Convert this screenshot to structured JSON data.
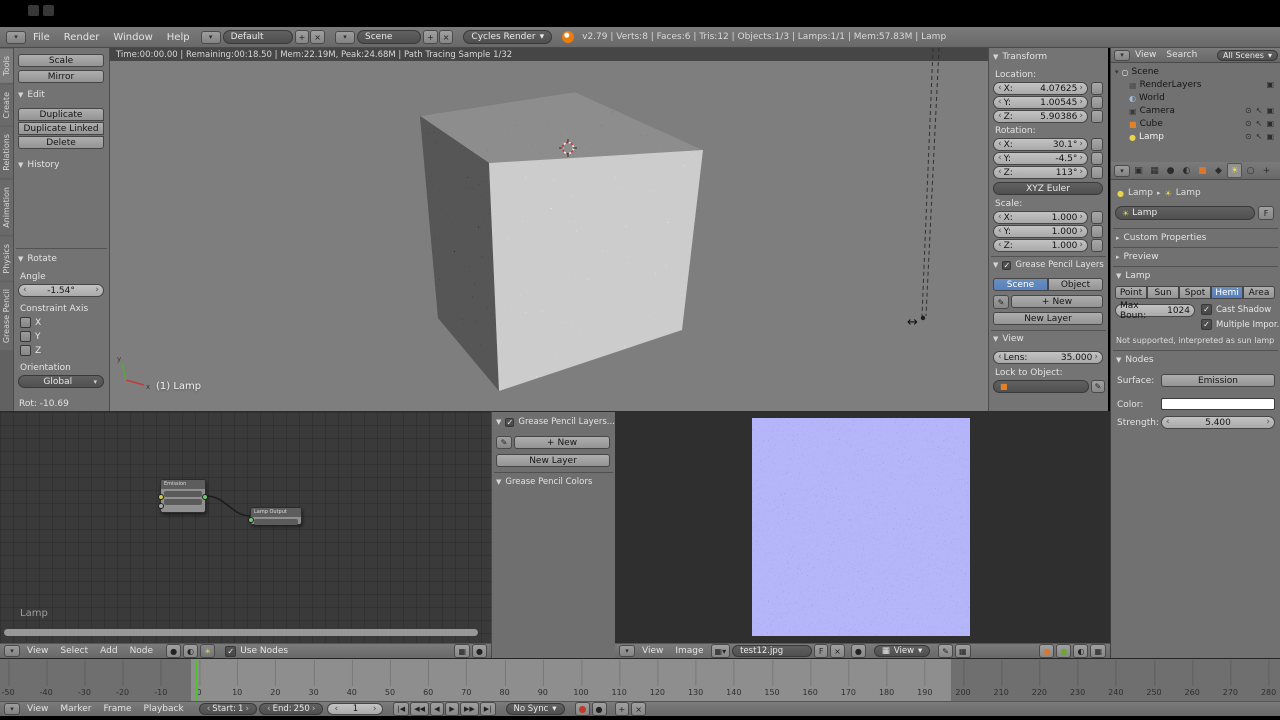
{
  "icons": {
    "dropdown": "▾",
    "collapse": "▼",
    "expand": "▸",
    "close": "×",
    "plus": "+",
    "check": "✓",
    "eye": "⊙",
    "select_arrow": "↖",
    "render_cam": "▣",
    "world_sphere": "◐",
    "image_layers": "▦",
    "lamp_sun": "☀",
    "dot": "●",
    "cube": "■",
    "pencil": "✎",
    "resize_cursor": "↔",
    "arrow_left": "‹",
    "arrow_right": "›"
  },
  "topbar": {
    "menus": [
      "File",
      "Render",
      "Window",
      "Help"
    ],
    "screen_layout": "Default",
    "scene_name": "Scene",
    "engine": "Cycles Render",
    "stats": "v2.79 | Verts:8 | Faces:6 | Tris:12 | Objects:1/3 | Lamps:1/1 | Mem:57.83M | Lamp"
  },
  "tool_shelf": {
    "tabs": [
      "Tools",
      "Create",
      "Relations",
      "Animation",
      "Physics",
      "Grease Pencil"
    ],
    "buttons": [
      "Scale",
      "Mirror"
    ],
    "edit_label": "Edit",
    "edit_buttons": [
      "Duplicate",
      "Duplicate Linked",
      "Delete"
    ],
    "history_label": "History",
    "rotate": {
      "title": "Rotate",
      "angle_label": "Angle",
      "angle_value": "-1.54°",
      "constraint_label": "Constraint Axis",
      "axes": [
        "X",
        "Y",
        "Z"
      ],
      "orientation_label": "Orientation",
      "orientation_value": "Global"
    },
    "status": "Rot: -10.69"
  },
  "viewport": {
    "render_status": "Time:00:00.00 | Remaining:00:18.50 | Mem:22.19M, Peak:24.68M | Path Tracing Sample 1/32",
    "object_info": "(1) Lamp",
    "gizmo_x": "x",
    "gizmo_y": "y"
  },
  "n_panel": {
    "transform_title": "Transform",
    "location_label": "Location:",
    "loc": [
      {
        "axis": "X:",
        "value": "4.07625"
      },
      {
        "axis": "Y:",
        "value": "1.00545"
      },
      {
        "axis": "Z:",
        "value": "5.90386"
      }
    ],
    "rotation_label": "Rotation:",
    "rot": [
      {
        "axis": "X:",
        "value": "30.1°"
      },
      {
        "axis": "Y:",
        "value": "-4.5°"
      },
      {
        "axis": "Z:",
        "value": "113°"
      }
    ],
    "rotation_mode": "XYZ Euler",
    "scale_label": "Scale:",
    "scl": [
      {
        "axis": "X:",
        "value": "1.000"
      },
      {
        "axis": "Y:",
        "value": "1.000"
      },
      {
        "axis": "Z:",
        "value": "1.000"
      }
    ],
    "gp_title": "Grease Pencil Layers",
    "gp_scene": "Scene",
    "gp_object": "Object",
    "gp_new": "New",
    "gp_new_layer": "New Layer",
    "view_title": "View",
    "lens_label": "Lens:",
    "lens_value": "35.000",
    "lock_label": "Lock to Object:"
  },
  "outliner": {
    "menu_view": "View",
    "menu_search": "Search",
    "display_mode": "All Scenes",
    "items": [
      {
        "label": "Scene",
        "icon": "○"
      },
      {
        "label": "RenderLayers",
        "icon": "▦"
      },
      {
        "label": "World",
        "icon": "◐"
      },
      {
        "label": "Camera",
        "icon": "▣"
      },
      {
        "label": "Cube",
        "icon": "■"
      },
      {
        "label": "Lamp",
        "icon": "●"
      }
    ]
  },
  "properties": {
    "tab_icons": [
      "▣",
      "▦",
      "●",
      "◐",
      "■",
      "◆",
      "☀",
      "○",
      "+"
    ],
    "breadcrumb_object": "Lamp",
    "breadcrumb_data": "Lamp",
    "name_value": "Lamp",
    "fake_user": "F",
    "custom_properties_title": "Custom Properties",
    "preview_title": "Preview",
    "lamp_title": "Lamp",
    "lamp_types": [
      "Point",
      "Sun",
      "Spot",
      "Hemi",
      "Area"
    ],
    "max_bounces_label": "Max Boun:",
    "max_bounces_value": "1024",
    "cast_shadow_label": "Cast Shadow",
    "multiple_importance_label": "Multiple Impor...",
    "note": "Not supported, interpreted as sun lamp",
    "nodes_title": "Nodes",
    "surface_label": "Surface:",
    "surface_value": "Emission",
    "color_label": "Color:",
    "strength_label": "Strength:",
    "strength_value": "5.400"
  },
  "node_editor": {
    "menus": [
      "View",
      "Select",
      "Add",
      "Node"
    ],
    "use_nodes_label": "Use Nodes",
    "id_name": "Lamp",
    "nodes": [
      {
        "title": "Emission"
      },
      {
        "title": "Lamp Output"
      }
    ]
  },
  "image_toolshelf": {
    "gp_layers_title": "Grease Pencil Layers...",
    "new_label": "New",
    "new_layer_label": "New Layer",
    "gp_colors_title": "Grease Pencil Colors"
  },
  "image_editor": {
    "menu_view": "View",
    "menu_image": "Image",
    "image_name": "test12.jpg",
    "fake_user": "F",
    "view_mode": "View"
  },
  "timeline": {
    "menus": [
      "View",
      "Marker",
      "Frame",
      "Playback"
    ],
    "start_label": "Start:",
    "start_value": "1",
    "end_label": "End:",
    "end_value": "250",
    "current_frame": "1",
    "sync_mode": "No Sync",
    "playback": [
      {
        "name": "jump-to-start",
        "glyph": "|◀"
      },
      {
        "name": "prev-keyframe",
        "glyph": "◀◀"
      },
      {
        "name": "play-reverse",
        "glyph": "◀"
      },
      {
        "name": "play",
        "glyph": "▶"
      },
      {
        "name": "next-keyframe",
        "glyph": "▶▶"
      },
      {
        "name": "jump-to-end",
        "glyph": "▶|"
      }
    ],
    "ruler_labels": [
      "-50",
      "-40",
      "-30",
      "-20",
      "-10",
      "0",
      "10",
      "20",
      "30",
      "40",
      "50",
      "60",
      "70",
      "80",
      "90",
      "100",
      "110",
      "120",
      "130",
      "140",
      "150",
      "160",
      "170",
      "180",
      "190",
      "200",
      "210",
      "220",
      "230",
      "240",
      "250",
      "260",
      "270",
      "280"
    ]
  }
}
